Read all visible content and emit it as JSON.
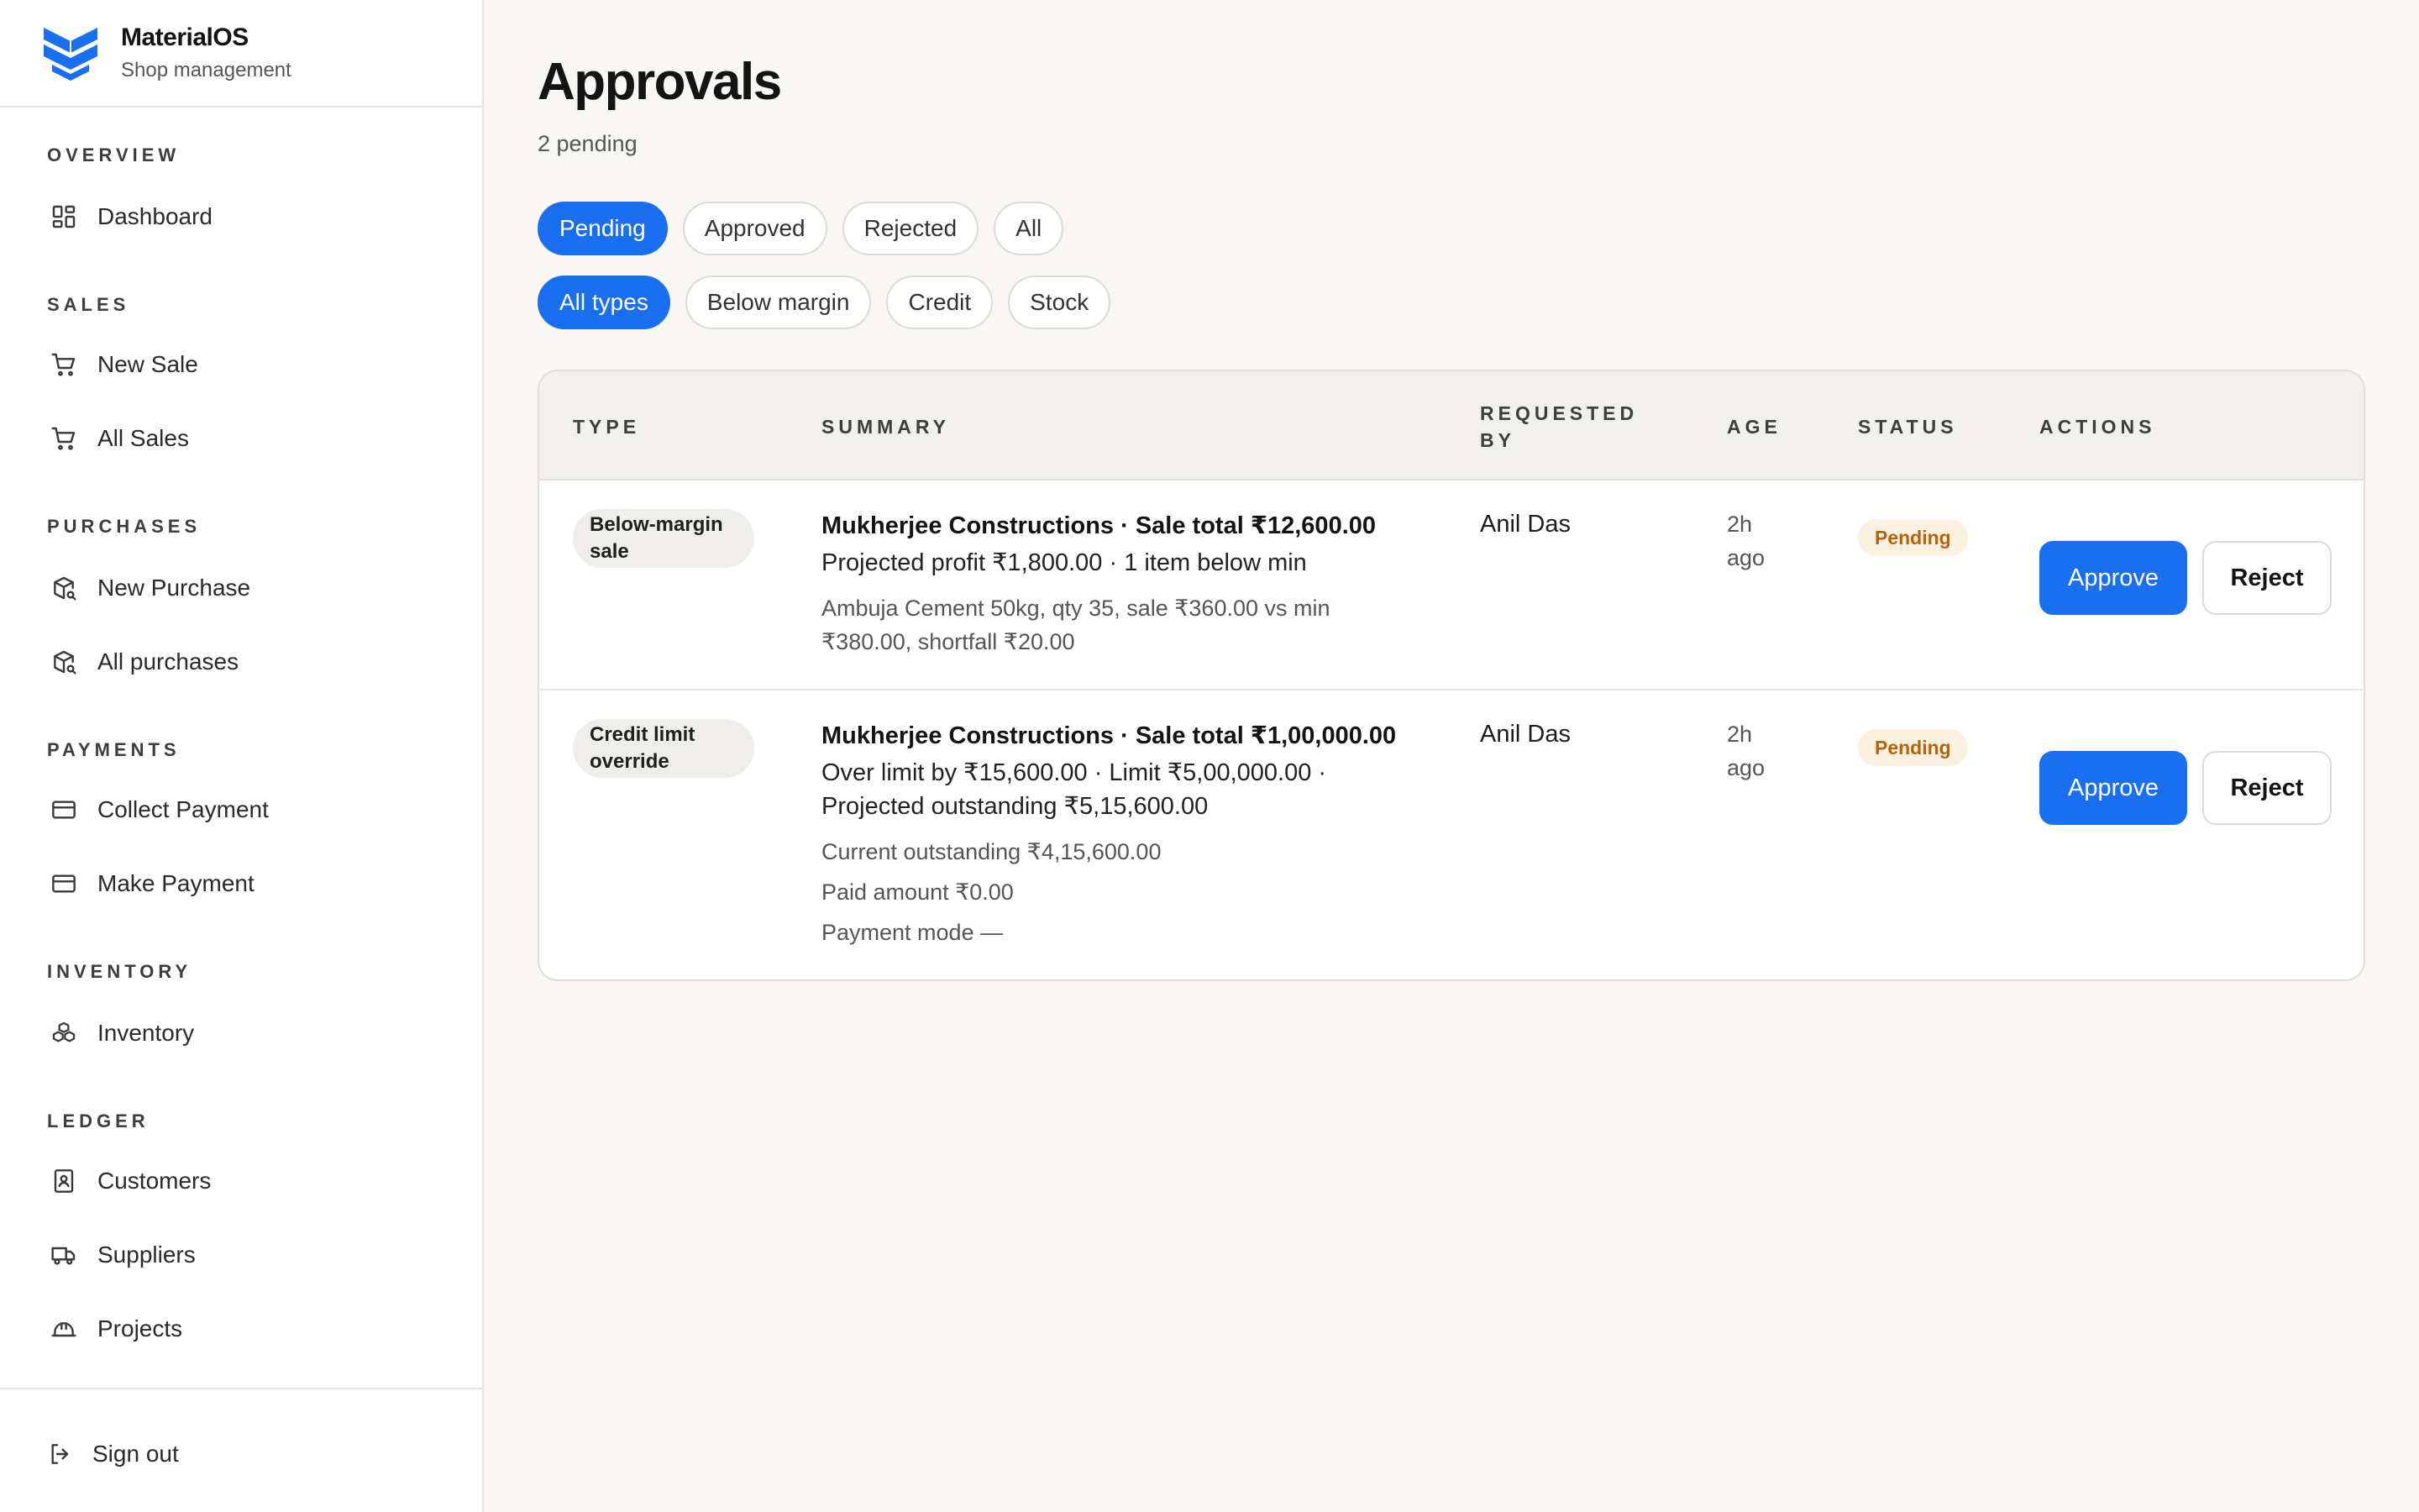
{
  "brand": {
    "name": "MaterialOS",
    "subtitle": "Shop management"
  },
  "sidebar": {
    "sections": [
      {
        "label": "OVERVIEW",
        "items": [
          {
            "label": "Dashboard",
            "icon": "dashboard-grid-icon"
          }
        ]
      },
      {
        "label": "SALES",
        "items": [
          {
            "label": "New Sale",
            "icon": "cart-icon"
          },
          {
            "label": "All Sales",
            "icon": "cart-icon"
          }
        ]
      },
      {
        "label": "PURCHASES",
        "items": [
          {
            "label": "New Purchase",
            "icon": "package-search-icon"
          },
          {
            "label": "All purchases",
            "icon": "package-search-icon"
          }
        ]
      },
      {
        "label": "PAYMENTS",
        "items": [
          {
            "label": "Collect Payment",
            "icon": "credit-card-icon"
          },
          {
            "label": "Make Payment",
            "icon": "credit-card-icon"
          }
        ]
      },
      {
        "label": "INVENTORY",
        "items": [
          {
            "label": "Inventory",
            "icon": "boxes-icon"
          }
        ]
      },
      {
        "label": "LEDGER",
        "items": [
          {
            "label": "Customers",
            "icon": "contact-book-icon"
          },
          {
            "label": "Suppliers",
            "icon": "truck-icon"
          },
          {
            "label": "Projects",
            "icon": "hard-hat-icon"
          }
        ]
      }
    ],
    "signout": "Sign out"
  },
  "page": {
    "title": "Approvals",
    "subtitle": "2 pending"
  },
  "filters": {
    "status": [
      "Pending",
      "Approved",
      "Rejected",
      "All"
    ],
    "status_active": "Pending",
    "types": [
      "All types",
      "Below margin",
      "Credit",
      "Stock"
    ],
    "types_active": "All types"
  },
  "table": {
    "headers": {
      "type": "TYPE",
      "summary": "SUMMARY",
      "requested_by_1": "REQUESTED",
      "requested_by_2": "BY",
      "age": "AGE",
      "status": "STATUS",
      "actions": "ACTIONS"
    },
    "rows": [
      {
        "type_1": "Below-margin",
        "type_2": "sale",
        "title": "Mukherjee Constructions · Sale total ₹12,600.00",
        "line1": "Projected profit ₹1,800.00 · 1 item below min",
        "detail1": "Ambuja Cement 50kg, qty 35, sale ₹360.00 vs min",
        "detail2": "₹380.00, shortfall ₹20.00",
        "requested_by": "Anil Das",
        "age_1": "2h",
        "age_2": "ago",
        "status": "Pending",
        "approve": "Approve",
        "reject": "Reject"
      },
      {
        "type_1": "Credit limit",
        "type_2": "override",
        "title": "Mukherjee Constructions · Sale total ₹1,00,000.00",
        "line1": "Over limit by ₹15,600.00 · Limit ₹5,00,000.00 ·",
        "line2": "Projected outstanding ₹5,15,600.00",
        "detail1": "Current outstanding ₹4,15,600.00",
        "detail2": "Paid amount ₹0.00",
        "detail3": "Payment mode —",
        "requested_by": "Anil Das",
        "age_1": "2h",
        "age_2": "ago",
        "status": "Pending",
        "approve": "Approve",
        "reject": "Reject"
      }
    ]
  },
  "colors": {
    "accent": "#1a6ff0",
    "status_pending_bg": "#fcf1e0",
    "status_pending_text": "#b4630c",
    "background": "#f8f7f4"
  }
}
